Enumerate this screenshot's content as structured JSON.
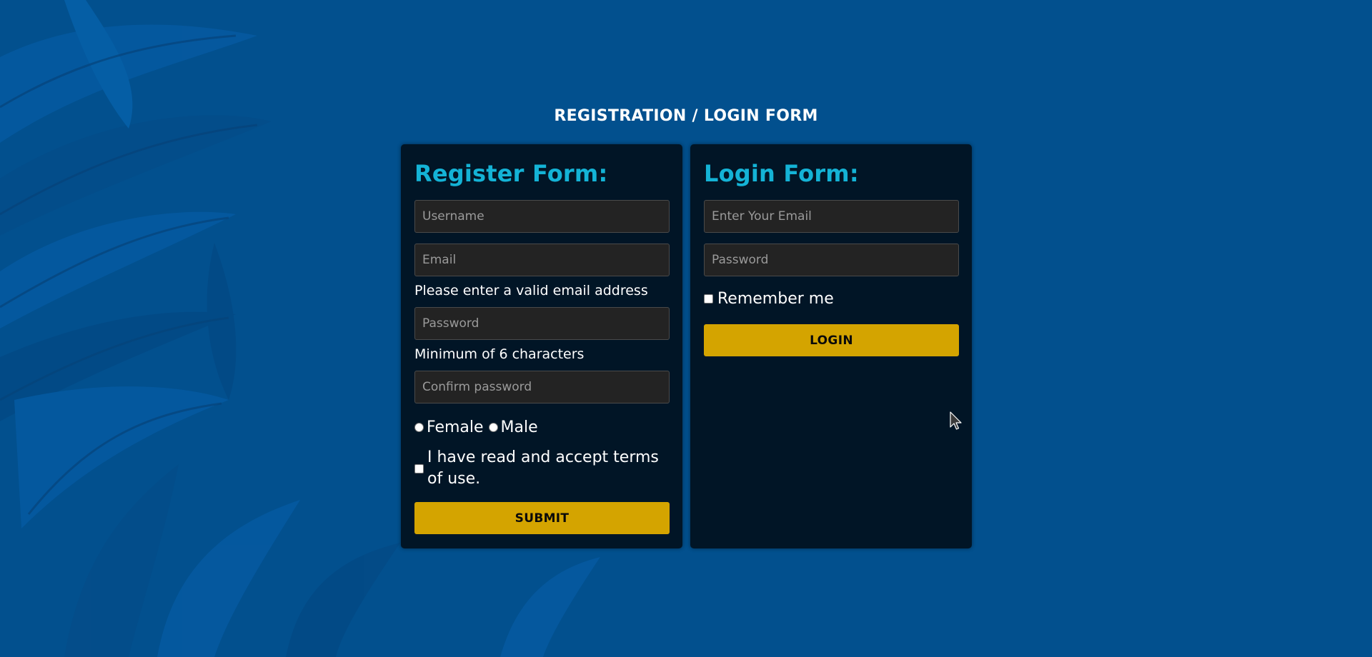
{
  "page": {
    "title": "REGISTRATION / LOGIN FORM"
  },
  "register": {
    "heading": "Register Form:",
    "username_placeholder": "Username",
    "email_placeholder": "Email",
    "email_hint": "Please enter a valid email address",
    "password_placeholder": "Password",
    "password_hint": "Minimum of 6 characters",
    "confirm_placeholder": "Confirm password",
    "gender_options": [
      "Female",
      "Male"
    ],
    "terms_label": "I have read and accept terms of use.",
    "submit_label": "SUBMIT"
  },
  "login": {
    "heading": "Login Form:",
    "email_placeholder": "Enter Your Email",
    "password_placeholder": "Password",
    "remember_label": "Remember me",
    "login_label": "LOGIN"
  },
  "colors": {
    "background": "#02508e",
    "panel": "#011526",
    "heading_accent": "#14b3d6",
    "button": "#d4a400",
    "input_bg": "#232323"
  },
  "icons": {
    "cursor": "mouse-pointer-icon"
  }
}
